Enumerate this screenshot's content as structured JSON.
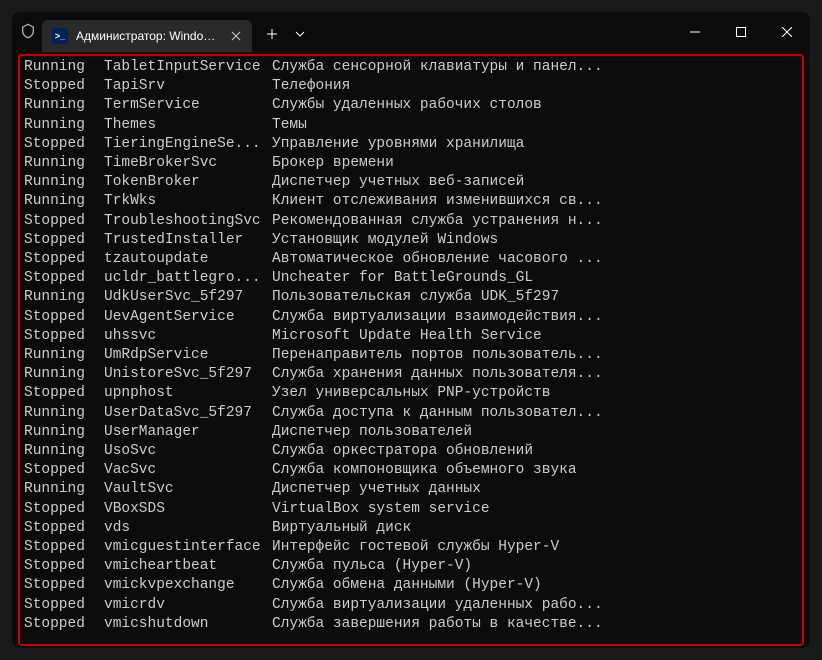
{
  "titlebar": {
    "tab_title": "Администратор: Windows Po",
    "ps_icon_text": ">_"
  },
  "services": [
    {
      "status": "Running",
      "name": "TabletInputService",
      "display": "Служба сенсорной клавиатуры и панел..."
    },
    {
      "status": "Stopped",
      "name": "TapiSrv",
      "display": "Телефония"
    },
    {
      "status": "Running",
      "name": "TermService",
      "display": "Службы удаленных рабочих столов"
    },
    {
      "status": "Running",
      "name": "Themes",
      "display": "Темы"
    },
    {
      "status": "Stopped",
      "name": "TieringEngineSe...",
      "display": "Управление уровнями хранилища"
    },
    {
      "status": "Running",
      "name": "TimeBrokerSvc",
      "display": "Брокер времени"
    },
    {
      "status": "Running",
      "name": "TokenBroker",
      "display": "Диспетчер учетных веб-записей"
    },
    {
      "status": "Running",
      "name": "TrkWks",
      "display": "Клиент отслеживания изменившихся св..."
    },
    {
      "status": "Stopped",
      "name": "TroubleshootingSvc",
      "display": "Рекомендованная служба устранения н..."
    },
    {
      "status": "Stopped",
      "name": "TrustedInstaller",
      "display": "Установщик модулей Windows"
    },
    {
      "status": "Stopped",
      "name": "tzautoupdate",
      "display": "Автоматическое обновление часового ..."
    },
    {
      "status": "Stopped",
      "name": "ucldr_battlegro...",
      "display": "Uncheater for BattleGrounds_GL"
    },
    {
      "status": "Running",
      "name": "UdkUserSvc_5f297",
      "display": "Пользовательская служба UDK_5f297"
    },
    {
      "status": "Stopped",
      "name": "UevAgentService",
      "display": "Служба виртуализации взаимодействия..."
    },
    {
      "status": "Stopped",
      "name": "uhssvc",
      "display": "Microsoft Update Health Service"
    },
    {
      "status": "Running",
      "name": "UmRdpService",
      "display": "Перенаправитель портов пользователь..."
    },
    {
      "status": "Running",
      "name": "UnistoreSvc_5f297",
      "display": "Служба хранения данных пользователя..."
    },
    {
      "status": "Stopped",
      "name": "upnphost",
      "display": "Узел универсальных PNP-устройств"
    },
    {
      "status": "Running",
      "name": "UserDataSvc_5f297",
      "display": "Служба доступа к данным пользовател..."
    },
    {
      "status": "Running",
      "name": "UserManager",
      "display": "Диспетчер пользователей"
    },
    {
      "status": "Running",
      "name": "UsoSvc",
      "display": "Служба оркестратора обновлений"
    },
    {
      "status": "Stopped",
      "name": "VacSvc",
      "display": "Служба компоновщика объемного звука"
    },
    {
      "status": "Running",
      "name": "VaultSvc",
      "display": "Диспетчер учетных данных"
    },
    {
      "status": "Stopped",
      "name": "VBoxSDS",
      "display": "VirtualBox system service"
    },
    {
      "status": "Stopped",
      "name": "vds",
      "display": "Виртуальный диск"
    },
    {
      "status": "Stopped",
      "name": "vmicguestinterface",
      "display": "Интерфейс гостевой службы Hyper-V"
    },
    {
      "status": "Stopped",
      "name": "vmicheartbeat",
      "display": "Служба пульса (Hyper-V)"
    },
    {
      "status": "Stopped",
      "name": "vmickvpexchange",
      "display": "Служба обмена данными (Hyper-V)"
    },
    {
      "status": "Stopped",
      "name": "vmicrdv",
      "display": "Служба виртуализации удаленных рабо..."
    },
    {
      "status": "Stopped",
      "name": "vmicshutdown",
      "display": "Служба завершения работы в качестве..."
    }
  ]
}
